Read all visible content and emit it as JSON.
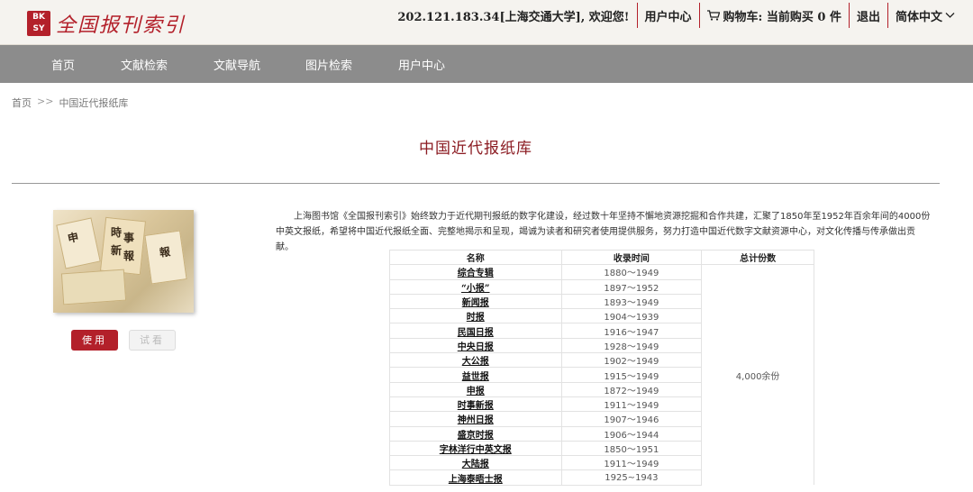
{
  "header": {
    "logo_mark": "BK\nSY",
    "logo_text": "全国报刊索引",
    "ip_welcome": "202.121.183.34[上海交通大学], 欢迎您!",
    "user_center": "用户中心",
    "cart_label": "购物车: 当前购买 0 件",
    "logout": "退出",
    "language": "简体中文"
  },
  "nav": {
    "items": [
      "首页",
      "文献检索",
      "文献导航",
      "图片检索",
      "用户中心"
    ]
  },
  "breadcrumb": {
    "home": "首页",
    "arrow": ">>",
    "current": "中国近代报纸库"
  },
  "page_title": "中国近代报纸库",
  "thumbnail_glyphs": [
    "時",
    "事",
    "新",
    "報",
    "申",
    "報"
  ],
  "buttons": {
    "use": "使用",
    "trial": "试看"
  },
  "intro": "上海图书馆《全国报刊索引》始终致力于近代期刊报纸的数字化建设，经过数十年坚持不懈地资源挖掘和合作共建，汇聚了1850年至1952年百余年间的4000份中英文报纸，希望将中国近代报纸全面、完整地揭示和呈现，竭诚为读者和研究者使用提供服务，努力打造中国近代数字文献资源中心，对文化传播与传承做出贡献。",
  "table": {
    "headers": [
      "名称",
      "收录时间",
      "总计份数"
    ],
    "total": "4,000余份",
    "rows": [
      {
        "name": "综合专辑",
        "time": "1880～1949"
      },
      {
        "name": "“小报”",
        "time": "1897～1952"
      },
      {
        "name": "新闻报",
        "time": "1893～1949"
      },
      {
        "name": "时报",
        "time": "1904～1939"
      },
      {
        "name": "民国日报",
        "time": "1916～1947"
      },
      {
        "name": "中央日报",
        "time": "1928～1949"
      },
      {
        "name": "大公报",
        "time": "1902～1949"
      },
      {
        "name": "益世报",
        "time": "1915～1949"
      },
      {
        "name": "申报",
        "time": "1872～1949"
      },
      {
        "name": "时事新报",
        "time": "1911～1949"
      },
      {
        "name": "神州日报",
        "time": "1907～1946"
      },
      {
        "name": "盛京时报",
        "time": "1906～1944"
      },
      {
        "name": "字林洋行中英文报",
        "time": "1850～1951"
      },
      {
        "name": "大陆报",
        "time": "1911～1949"
      },
      {
        "name": "上海泰晤士报",
        "time": "1925~1943"
      }
    ]
  }
}
